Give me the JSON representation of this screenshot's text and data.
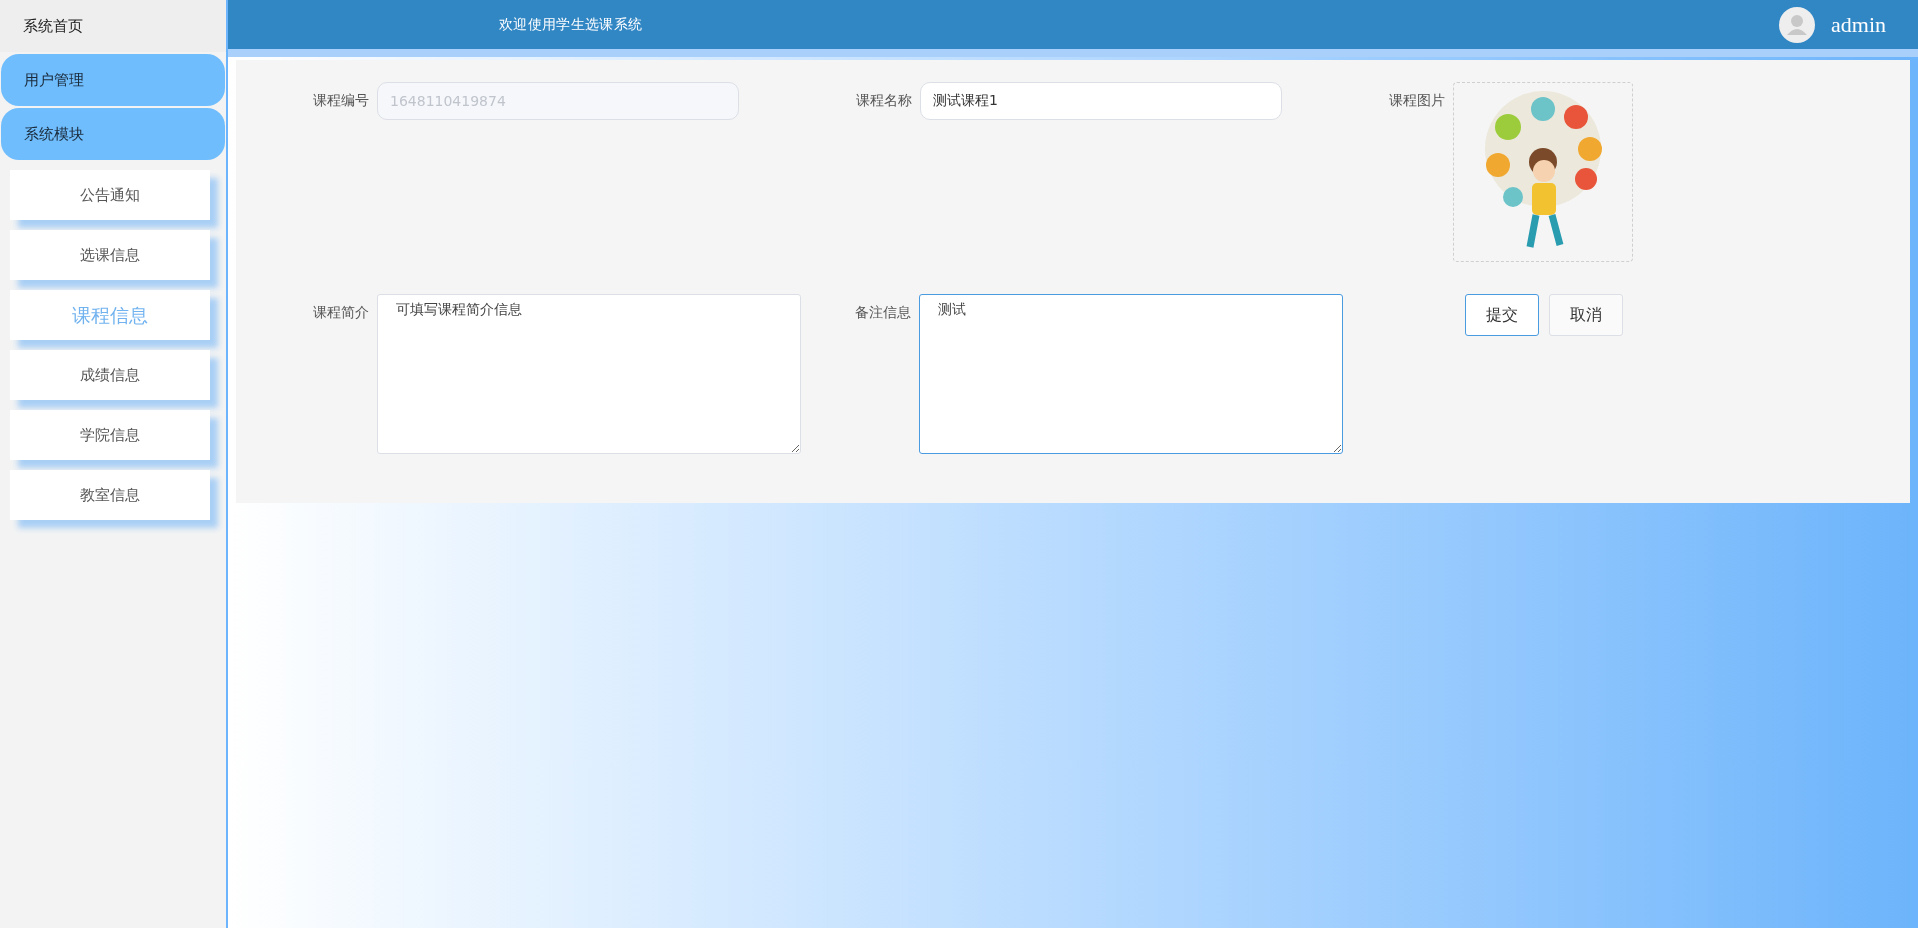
{
  "sidebar": {
    "home": "系统首页",
    "groups": [
      {
        "label": "用户管理"
      },
      {
        "label": "系统模块"
      }
    ],
    "items": [
      {
        "label": "公告通知",
        "selected": false
      },
      {
        "label": "选课信息",
        "selected": false
      },
      {
        "label": "课程信息",
        "selected": true
      },
      {
        "label": "成绩信息",
        "selected": false
      },
      {
        "label": "学院信息",
        "selected": false
      },
      {
        "label": "教室信息",
        "selected": false
      }
    ]
  },
  "header": {
    "title": "欢迎使用学生选课系统",
    "user": "admin"
  },
  "form": {
    "row1": [
      {
        "kind": "input",
        "label": "课程编号",
        "value": "1648110419874",
        "disabled": true,
        "focused": false
      },
      {
        "kind": "input",
        "label": "课程名称",
        "value": "测试课程1",
        "disabled": false,
        "focused": false
      },
      {
        "kind": "image",
        "label": "课程图片"
      }
    ],
    "row2": [
      {
        "kind": "textarea",
        "label": "课程简介",
        "value": "可填写课程简介信息",
        "focused": false
      },
      {
        "kind": "textarea",
        "label": "备注信息",
        "value": "测试",
        "focused": true
      }
    ],
    "buttons": [
      {
        "label": "提交",
        "primary": true
      },
      {
        "label": "取消",
        "primary": false
      }
    ]
  }
}
